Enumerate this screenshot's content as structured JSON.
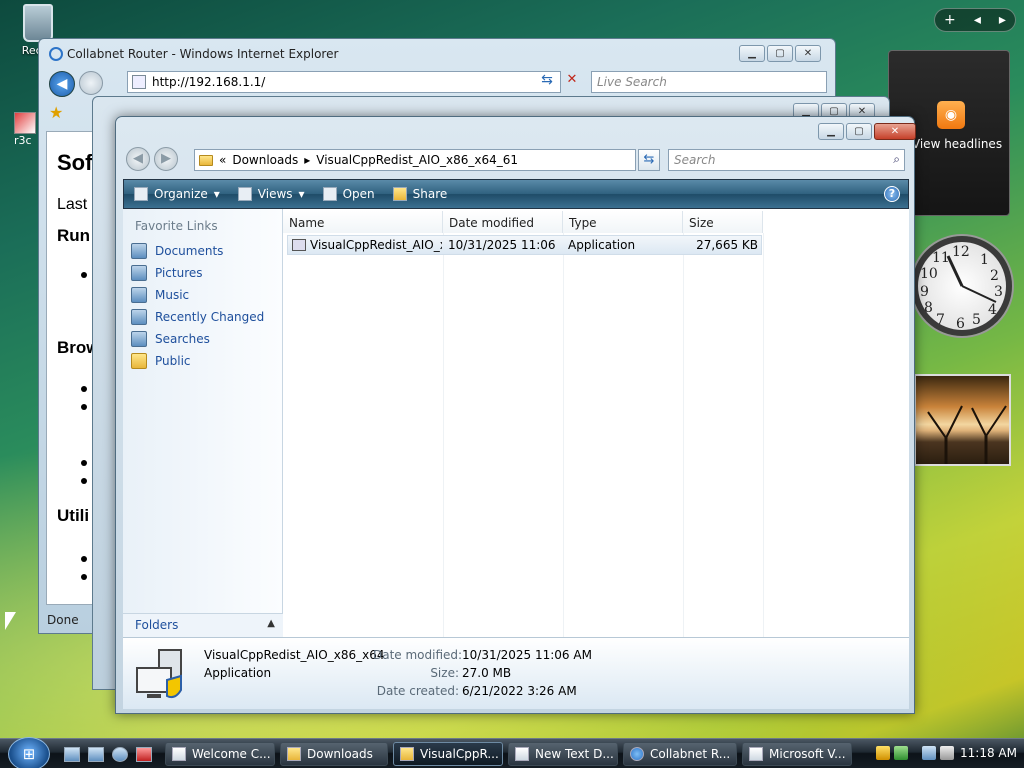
{
  "desktop": {
    "recycle_label": "Recyc",
    "side_label": "r3c"
  },
  "sidebar": {
    "controls": [
      "+",
      "◂",
      "▸"
    ],
    "feed_text": "View headlines",
    "clock_numbers": [
      "12",
      "1",
      "2",
      "3",
      "4",
      "5",
      "6",
      "7",
      "8",
      "9",
      "10",
      "11"
    ]
  },
  "ie": {
    "title": "Collabnet Router - Windows Internet Explorer",
    "address": "http://192.168.1.1/",
    "search_placeholder": "Live Search",
    "content": {
      "heading": "Sof",
      "last": "Last",
      "section_run": "Run",
      "section_brow": "Brow",
      "section_util": "Utili"
    },
    "status": "Done"
  },
  "explorer": {
    "breadcrumb": [
      "«",
      "Downloads",
      "▸",
      "VisualCppRedist_AIO_x86_x64_61"
    ],
    "search_placeholder": "Search",
    "toolbar": {
      "organize": "Organize",
      "views": "Views",
      "open": "Open",
      "share": "Share"
    },
    "nav": {
      "title": "Favorite Links",
      "items": [
        "Documents",
        "Pictures",
        "Music",
        "Recently Changed",
        "Searches",
        "Public"
      ],
      "folders_label": "Folders"
    },
    "columns": [
      "Name",
      "Date modified",
      "Type",
      "Size"
    ],
    "files": [
      {
        "name": "VisualCppRedist_AIO_x...",
        "date": "10/31/2025 11:06 ...",
        "type": "Application",
        "size": "27,665 KB"
      }
    ],
    "details": {
      "filename": "VisualCppRedist_AIO_x86_x64",
      "filetype": "Application",
      "date_modified_label": "Date modified:",
      "date_modified": "10/31/2025 11:06 AM",
      "size_label": "Size:",
      "size": "27.0 MB",
      "date_created_label": "Date created:",
      "date_created": "6/21/2022 3:26 AM"
    }
  },
  "taskbar": {
    "tasks": [
      "Welcome C...",
      "Downloads",
      "VisualCppR...",
      "New Text D...",
      "Collabnet R...",
      "Microsoft V..."
    ],
    "clock": "11:18 AM"
  }
}
